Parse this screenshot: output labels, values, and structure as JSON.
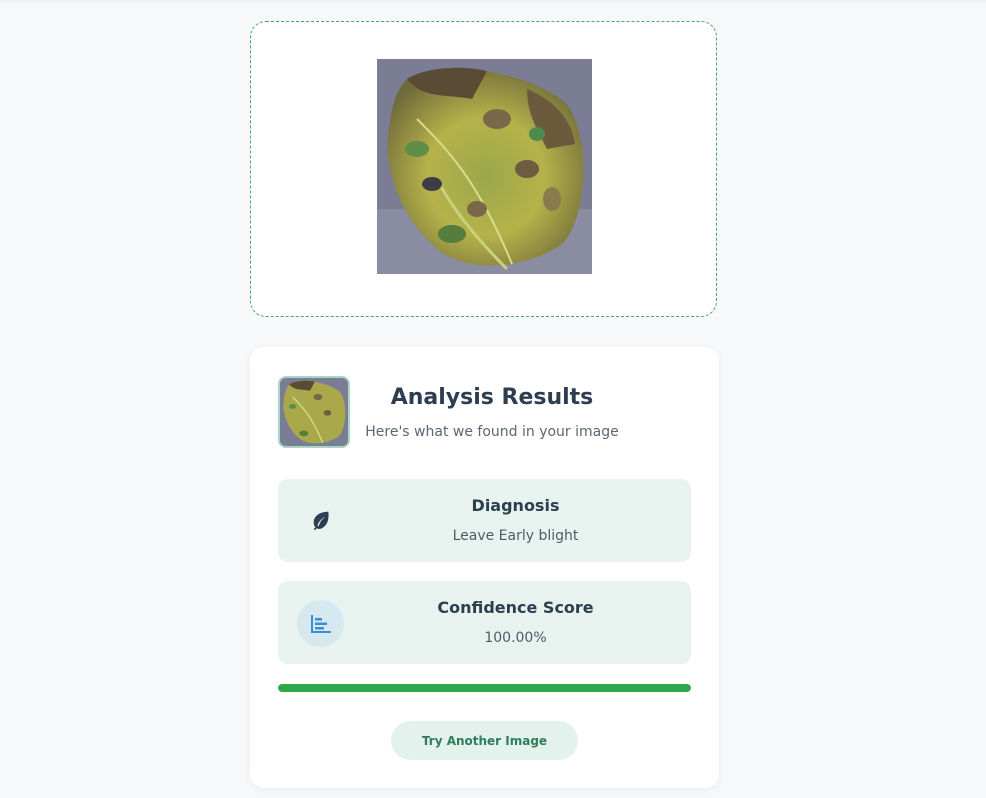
{
  "results": {
    "title": "Analysis Results",
    "subtitle": "Here's what we found in your image"
  },
  "diagnosis": {
    "label": "Diagnosis",
    "value": "Leave Early blight",
    "icon": "leaf-icon"
  },
  "confidence": {
    "label": "Confidence Score",
    "value": "100.00%",
    "progress": 1.0,
    "icon": "bar-chart-icon"
  },
  "actions": {
    "try_another_label": "Try Another Image"
  },
  "colors": {
    "accent": "#2ea84a",
    "text_dark": "#2c3e50",
    "box_bg": "#e8f3ef",
    "button_text": "#2e7d5b"
  }
}
